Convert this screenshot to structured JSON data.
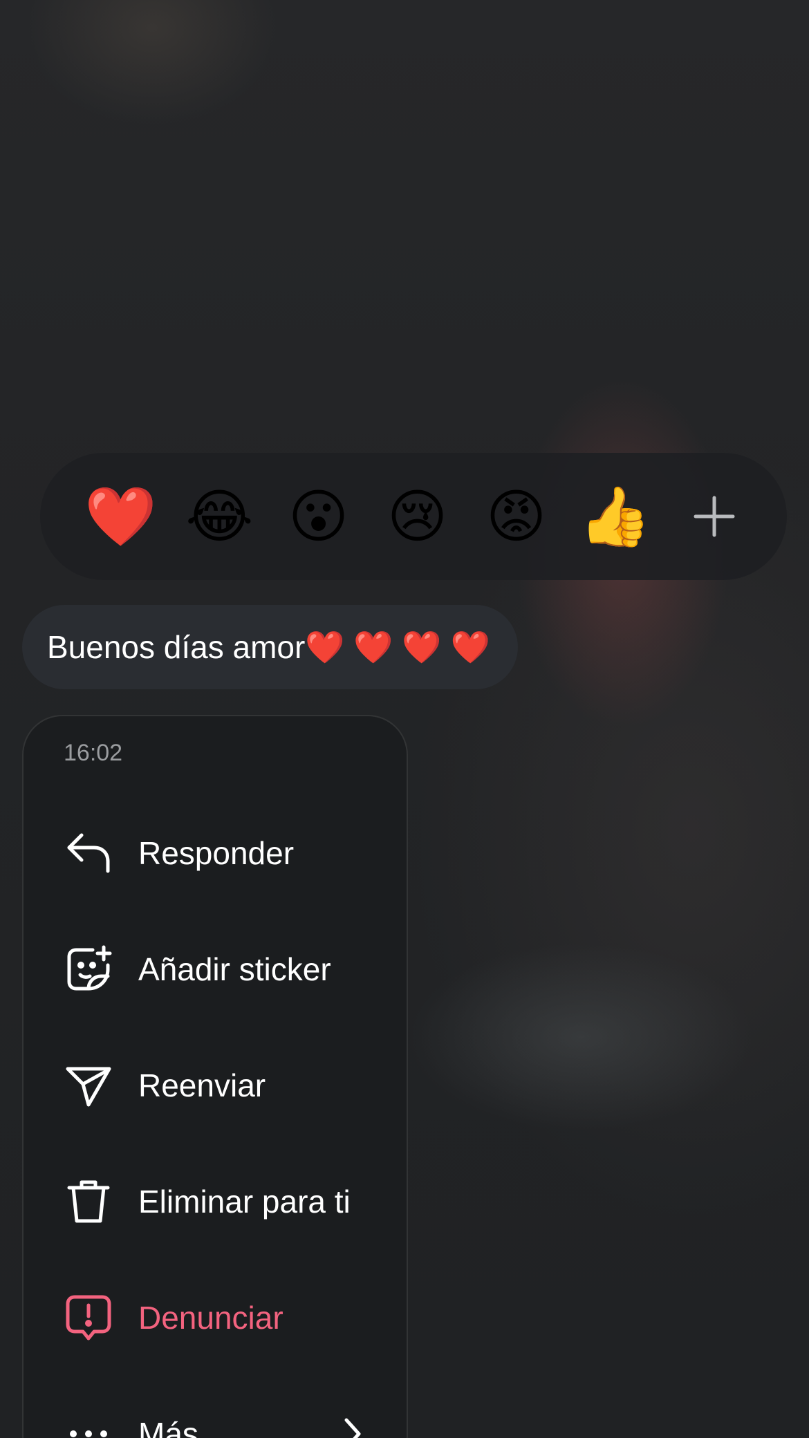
{
  "reactions": {
    "emojis": [
      "❤️",
      "😂",
      "😮",
      "😢",
      "😡",
      "👍"
    ],
    "add_icon": "plus-icon"
  },
  "message": {
    "text": "Buenos días amor❤️ ❤️ ❤️ ❤️"
  },
  "menu": {
    "time": "16:02",
    "items": [
      {
        "label": "Responder",
        "icon": "reply-icon"
      },
      {
        "label": "Añadir sticker",
        "icon": "sticker-add-icon"
      },
      {
        "label": "Reenviar",
        "icon": "send-icon"
      },
      {
        "label": "Eliminar para ti",
        "icon": "trash-icon"
      },
      {
        "label": "Denunciar",
        "icon": "report-icon"
      },
      {
        "label": "Más",
        "icon": "more-icon"
      }
    ]
  },
  "colors": {
    "danger": "#f3637f",
    "menu_background": "#1b1d1f",
    "bubble_background": "#2a2d32",
    "reaction_bar_background": "#1e1f22"
  }
}
